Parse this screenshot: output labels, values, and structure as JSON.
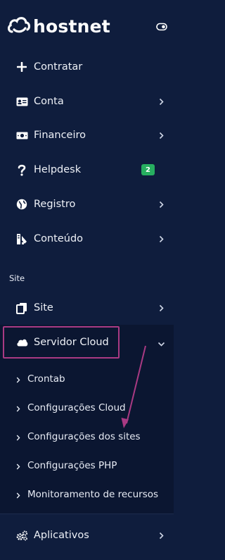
{
  "brand": {
    "name": "hostnet"
  },
  "menu": [
    {
      "label": "Contratar",
      "icon": "plus-icon"
    },
    {
      "label": "Conta",
      "icon": "id-card-icon"
    },
    {
      "label": "Financeiro",
      "icon": "money-bill-icon"
    },
    {
      "label": "Helpdesk",
      "icon": "question-icon",
      "badge": "2"
    },
    {
      "label": "Registro",
      "icon": "globe-icon"
    },
    {
      "label": "Conteúdo",
      "icon": "content-icon"
    }
  ],
  "section": {
    "label": "Site"
  },
  "site_menu": {
    "site": {
      "label": "Site",
      "icon": "copy-icon"
    },
    "servidor_cloud": {
      "label": "Servidor Cloud",
      "icon": "cloud-icon"
    },
    "submenu": [
      "Crontab",
      "Configurações Cloud",
      "Configurações dos sites",
      "Configurações PHP",
      "Monitoramento de recursos"
    ],
    "aplicativos": {
      "label": "Aplicativos",
      "icon": "cogs-icon"
    }
  },
  "colors": {
    "background": "#0f1d3d",
    "active_background": "#0b1631",
    "annotation": "#a93a83",
    "badge": "#27ae60"
  }
}
